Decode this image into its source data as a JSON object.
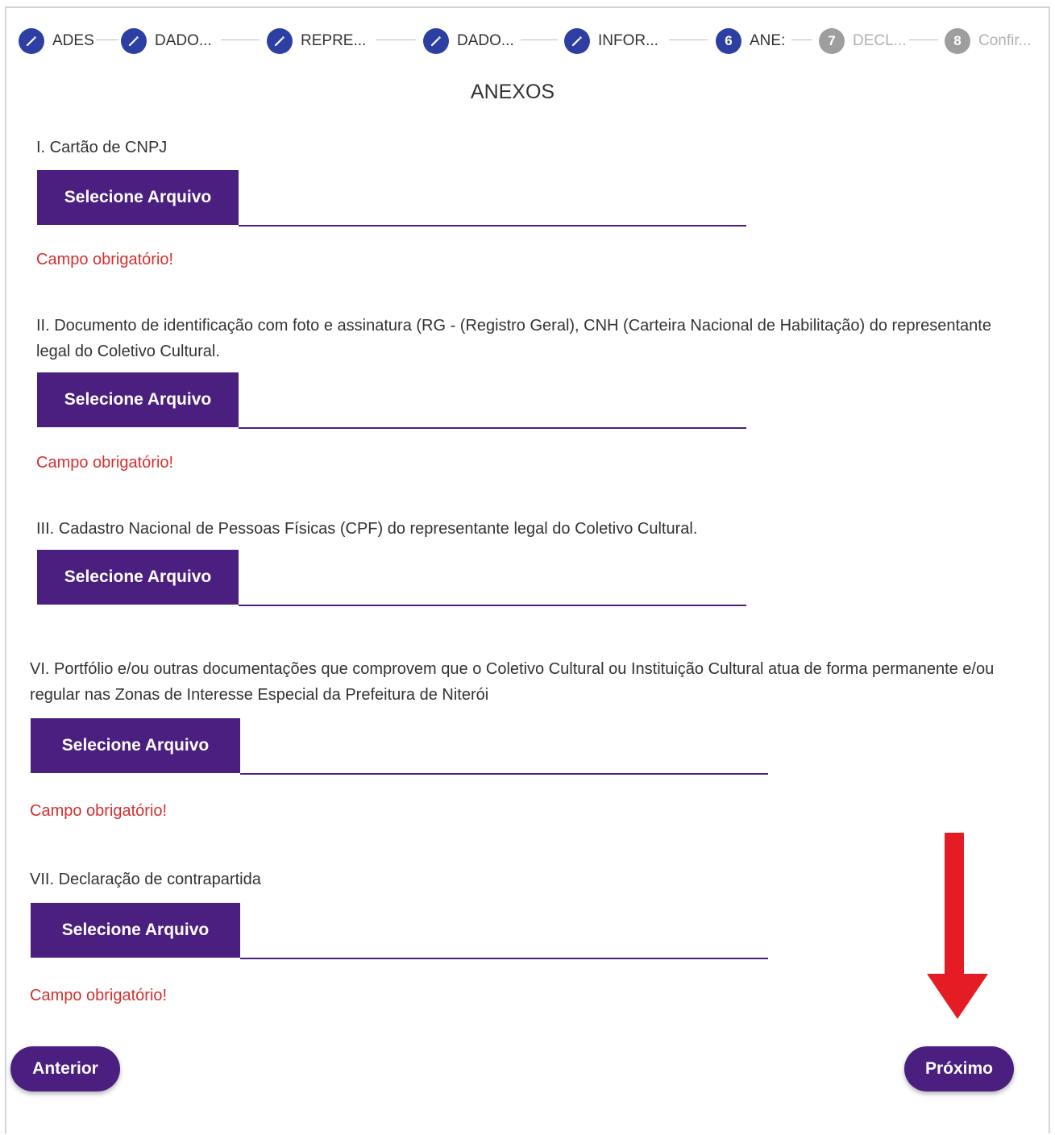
{
  "stepper": {
    "steps": [
      {
        "label": "ADES",
        "state": "done",
        "icon": "pencil-icon"
      },
      {
        "label": "DADO...",
        "state": "done",
        "icon": "pencil-icon"
      },
      {
        "label": "REPRE...",
        "state": "done",
        "icon": "pencil-icon"
      },
      {
        "label": "DADO...",
        "state": "done",
        "icon": "pencil-icon"
      },
      {
        "label": "INFOR...",
        "state": "done",
        "icon": "pencil-icon"
      },
      {
        "number": "6",
        "label": "ANE:",
        "state": "active"
      },
      {
        "number": "7",
        "label": "DECL...",
        "state": "todo"
      },
      {
        "number": "8",
        "label": "Confir...",
        "state": "todo"
      }
    ]
  },
  "page": {
    "title": "ANEXOS"
  },
  "fields": [
    {
      "label": "I. Cartão de CNPJ",
      "button": "Selecione Arquivo",
      "error": "Campo obrigatório!"
    },
    {
      "label": "II. Documento de identificação com foto e assinatura (RG - (Registro Geral), CNH (Carteira Nacional de Habilitação) do representante legal do Coletivo Cultural.",
      "button": "Selecione Arquivo",
      "error": "Campo obrigatório!"
    },
    {
      "label": "III. Cadastro Nacional de Pessoas Físicas (CPF) do representante legal do Coletivo Cultural.",
      "button": "Selecione Arquivo",
      "error": ""
    },
    {
      "label": "VI. Portfólio e/ou outras documentações que comprovem que o Coletivo Cultural ou Instituição Cultural atua de forma permanente e/ou regular nas Zonas de Interesse Especial da Prefeitura de Niterói",
      "button": "Selecione Arquivo",
      "error": "Campo obrigatório!"
    },
    {
      "label": "VII. Declaração de contrapartida",
      "button": "Selecione Arquivo",
      "error": "Campo obrigatório!"
    }
  ],
  "nav": {
    "previous": "Anterior",
    "next": "Próximo"
  },
  "colors": {
    "primary": "#4b1f80",
    "stepper": "#2e3fa3",
    "error": "#d32f2f",
    "annotation_arrow": "#e51c23"
  }
}
